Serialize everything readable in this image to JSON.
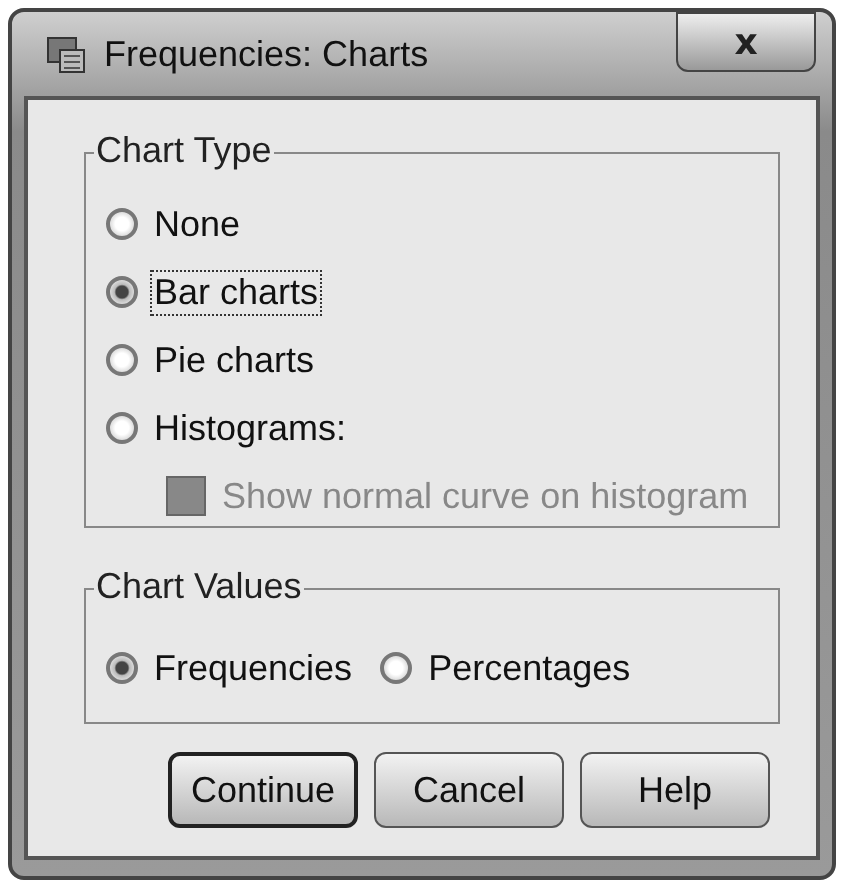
{
  "window": {
    "title": "Frequencies: Charts",
    "close": "x"
  },
  "chart_type": {
    "legend": "Chart Type",
    "options": [
      {
        "kind": "radio",
        "label": "None",
        "selected": false,
        "focused": false
      },
      {
        "kind": "radio",
        "label": "Bar charts",
        "selected": true,
        "focused": true
      },
      {
        "kind": "radio",
        "label": "Pie charts",
        "selected": false,
        "focused": false
      },
      {
        "kind": "radio",
        "label": "Histograms:",
        "selected": false,
        "focused": false
      },
      {
        "kind": "checkbox",
        "label": "Show normal curve on histogram",
        "checked": false,
        "disabled": true
      }
    ]
  },
  "chart_values": {
    "legend": "Chart Values",
    "options": [
      {
        "label": "Frequencies",
        "selected": true
      },
      {
        "label": "Percentages",
        "selected": false
      }
    ]
  },
  "buttons": [
    {
      "label": "Continue",
      "default": true
    },
    {
      "label": "Cancel",
      "default": false
    },
    {
      "label": "Help",
      "default": false
    }
  ]
}
